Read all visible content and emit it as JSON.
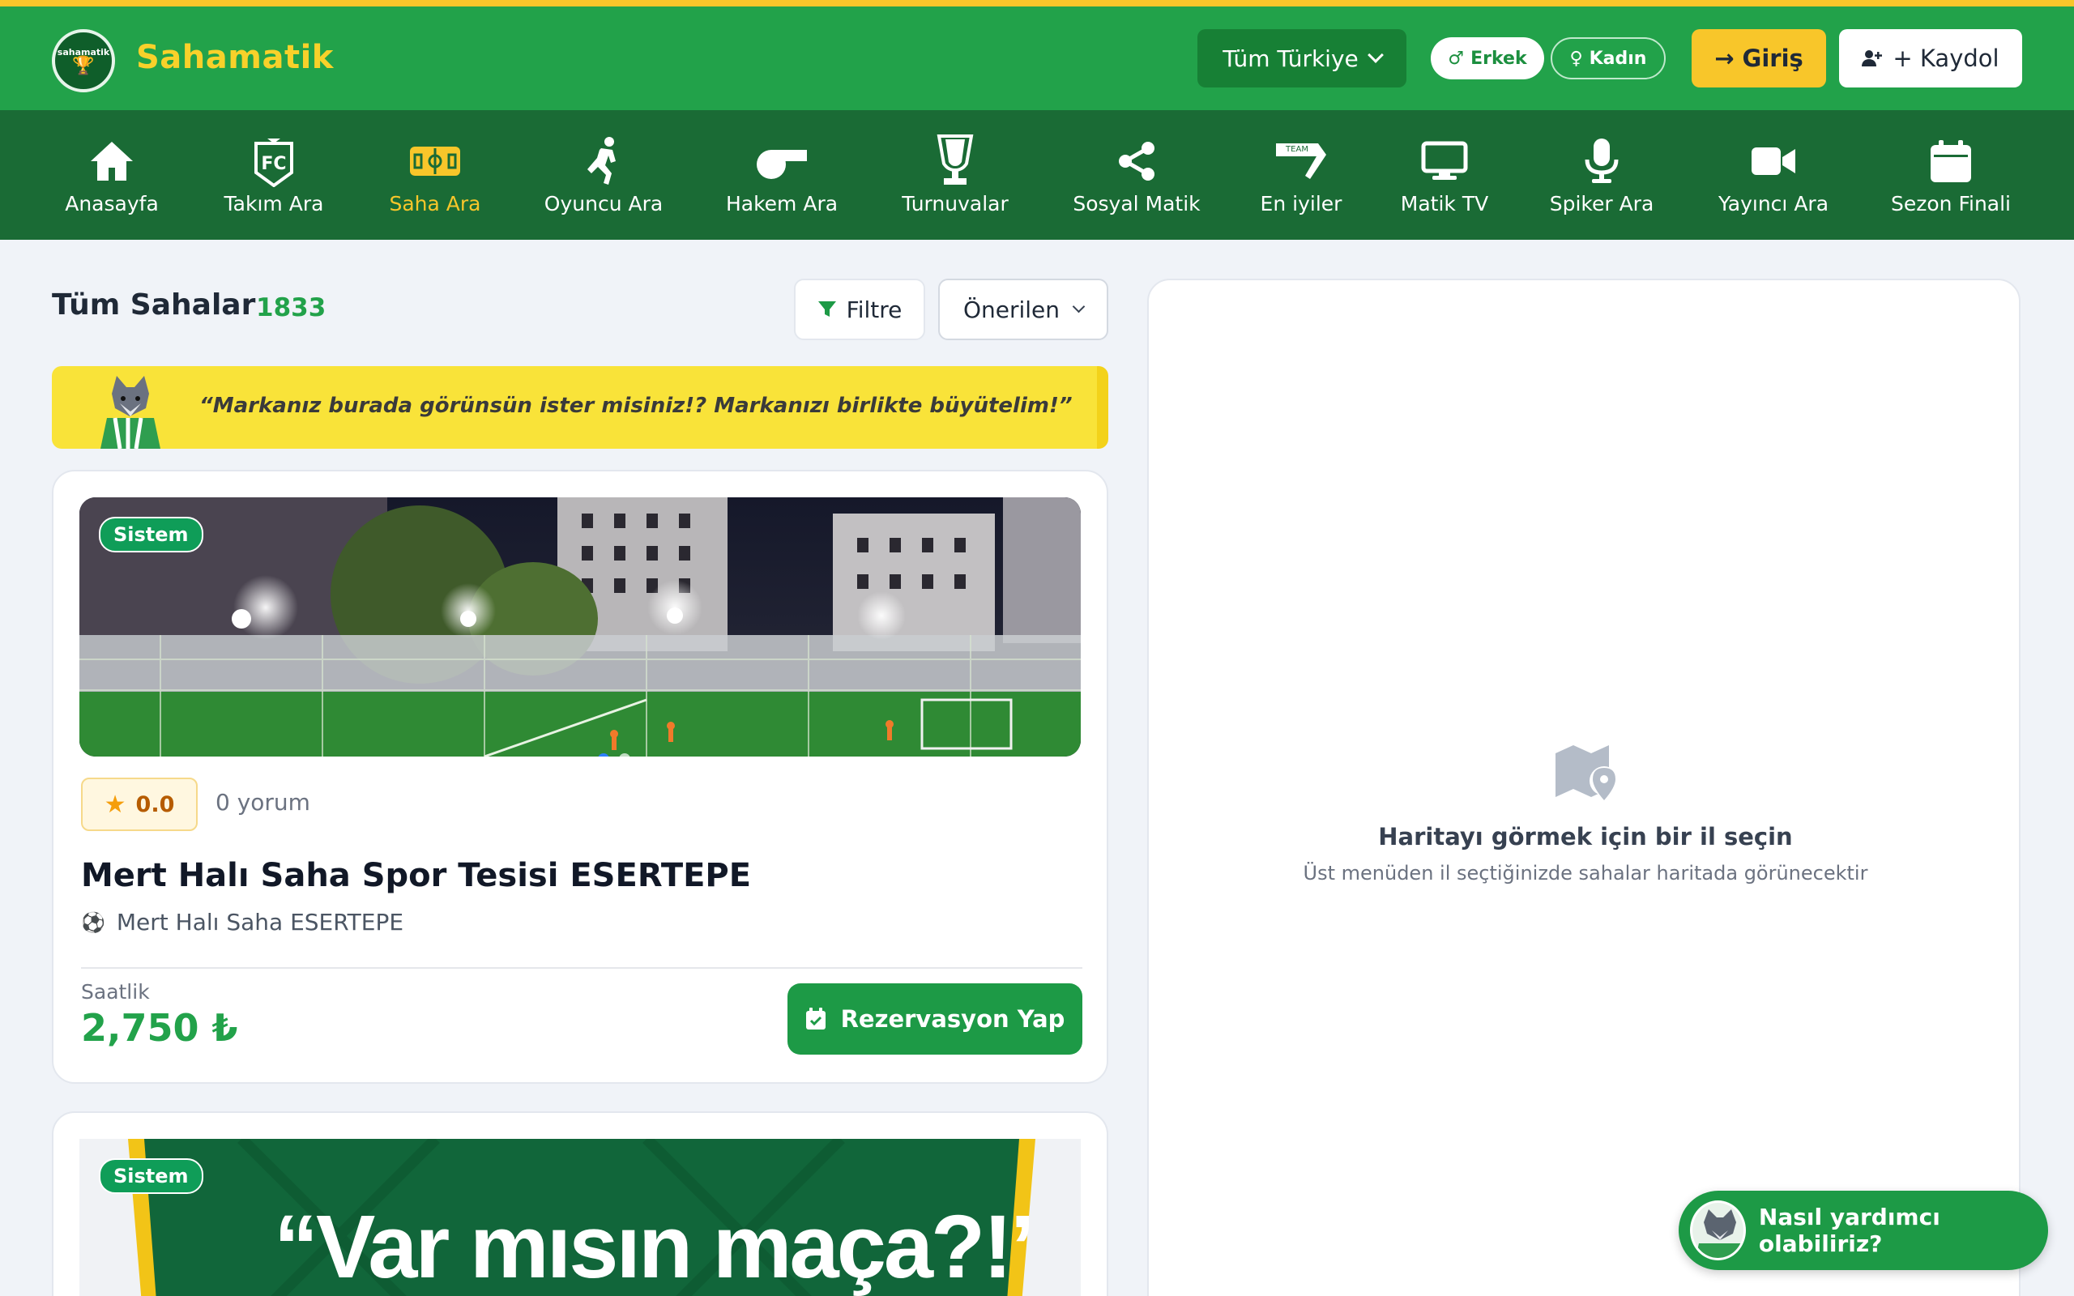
{
  "brand": {
    "name": "Sahamatik",
    "logo_top": "sahamatik",
    "accent": "#22a24a",
    "yellow": "#f8c62a"
  },
  "header": {
    "location_select": "Tüm Türkiye",
    "gender_male": "Erkek",
    "gender_female": "Kadın",
    "login": "Giriş",
    "signup": "+ Kaydol"
  },
  "nav": {
    "items": [
      {
        "label": "Anasayfa",
        "icon": "home-icon"
      },
      {
        "label": "Takım Ara",
        "icon": "fc-badge-icon"
      },
      {
        "label": "Saha Ara",
        "icon": "field-icon",
        "active": true
      },
      {
        "label": "Oyuncu Ara",
        "icon": "player-icon"
      },
      {
        "label": "Hakem Ara",
        "icon": "whistle-icon"
      },
      {
        "label": "Turnuvalar",
        "icon": "trophy-icon"
      },
      {
        "label": "Sosyal Matik",
        "icon": "share-icon"
      },
      {
        "label": "En iyiler",
        "icon": "team-flag-icon"
      },
      {
        "label": "Matik TV",
        "icon": "monitor-icon"
      },
      {
        "label": "Spiker Ara",
        "icon": "microphone-icon"
      },
      {
        "label": "Yayıncı Ara",
        "icon": "video-camera-icon"
      },
      {
        "label": "Sezon Finali",
        "icon": "calendar-icon"
      }
    ]
  },
  "list": {
    "title": "Tüm Sahalar",
    "count": "1833",
    "filter_label": "Filtre",
    "sort_value": "Önerilen"
  },
  "ad_banner": {
    "text": "“Markanız burada görünsün ister misiniz!? Markanızı birlikte büyütelim!”"
  },
  "venues": [
    {
      "badge": "Sistem",
      "rating": "0.0",
      "reviews": "0 yorum",
      "name": "Mert Halı Saha Spor Tesisi ESERTEPE",
      "subtitle": "Mert Halı Saha ESERTEPE",
      "price_label": "Saatlik",
      "price": "2,750 ₺",
      "reserve_label": "Rezervasyon Yap"
    },
    {
      "badge": "Sistem",
      "promo_text": "“Var mısın maça?!’"
    }
  ],
  "map": {
    "title": "Haritayı görmek için bir il seçin",
    "subtitle": "Üst menüden il seçtiğinizde sahalar haritada görünecektir"
  },
  "help": {
    "label": "Nasıl yardımcı olabiliriz?"
  }
}
